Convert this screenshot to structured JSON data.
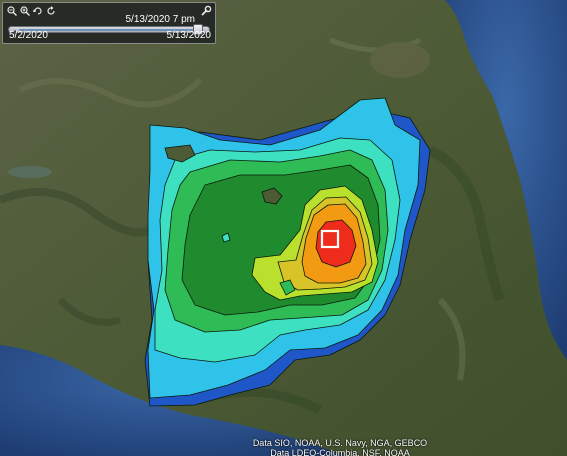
{
  "time_slider": {
    "current_time": "5/13/2020  7 pm",
    "start_date": "5/2/2020",
    "end_date": "5/13/2020",
    "position_fraction": 0.99
  },
  "attribution": {
    "line1": "Data SIO, NOAA, U.S. Navy, NGA, GEBCO",
    "line2": "Data LDEO-Columbia, NSF, NOAA"
  },
  "icons": [
    "zoom-out-icon",
    "zoom-in-icon",
    "loop-icon",
    "refresh-icon",
    "settings-icon",
    "marker-square-icon"
  ],
  "colors": {
    "ocean": "#2a4f8c",
    "band_blue": "#1f56c8",
    "band_cyan": "#2fc3e9",
    "band_aqua": "#3de0c0",
    "band_green": "#2fbb55",
    "band_darkgreen": "#1f8a2e",
    "band_yellowgreen": "#b8e02c",
    "band_orange": "#f29b12",
    "band_red": "#ef2b1b",
    "marker": "#ffffff"
  }
}
